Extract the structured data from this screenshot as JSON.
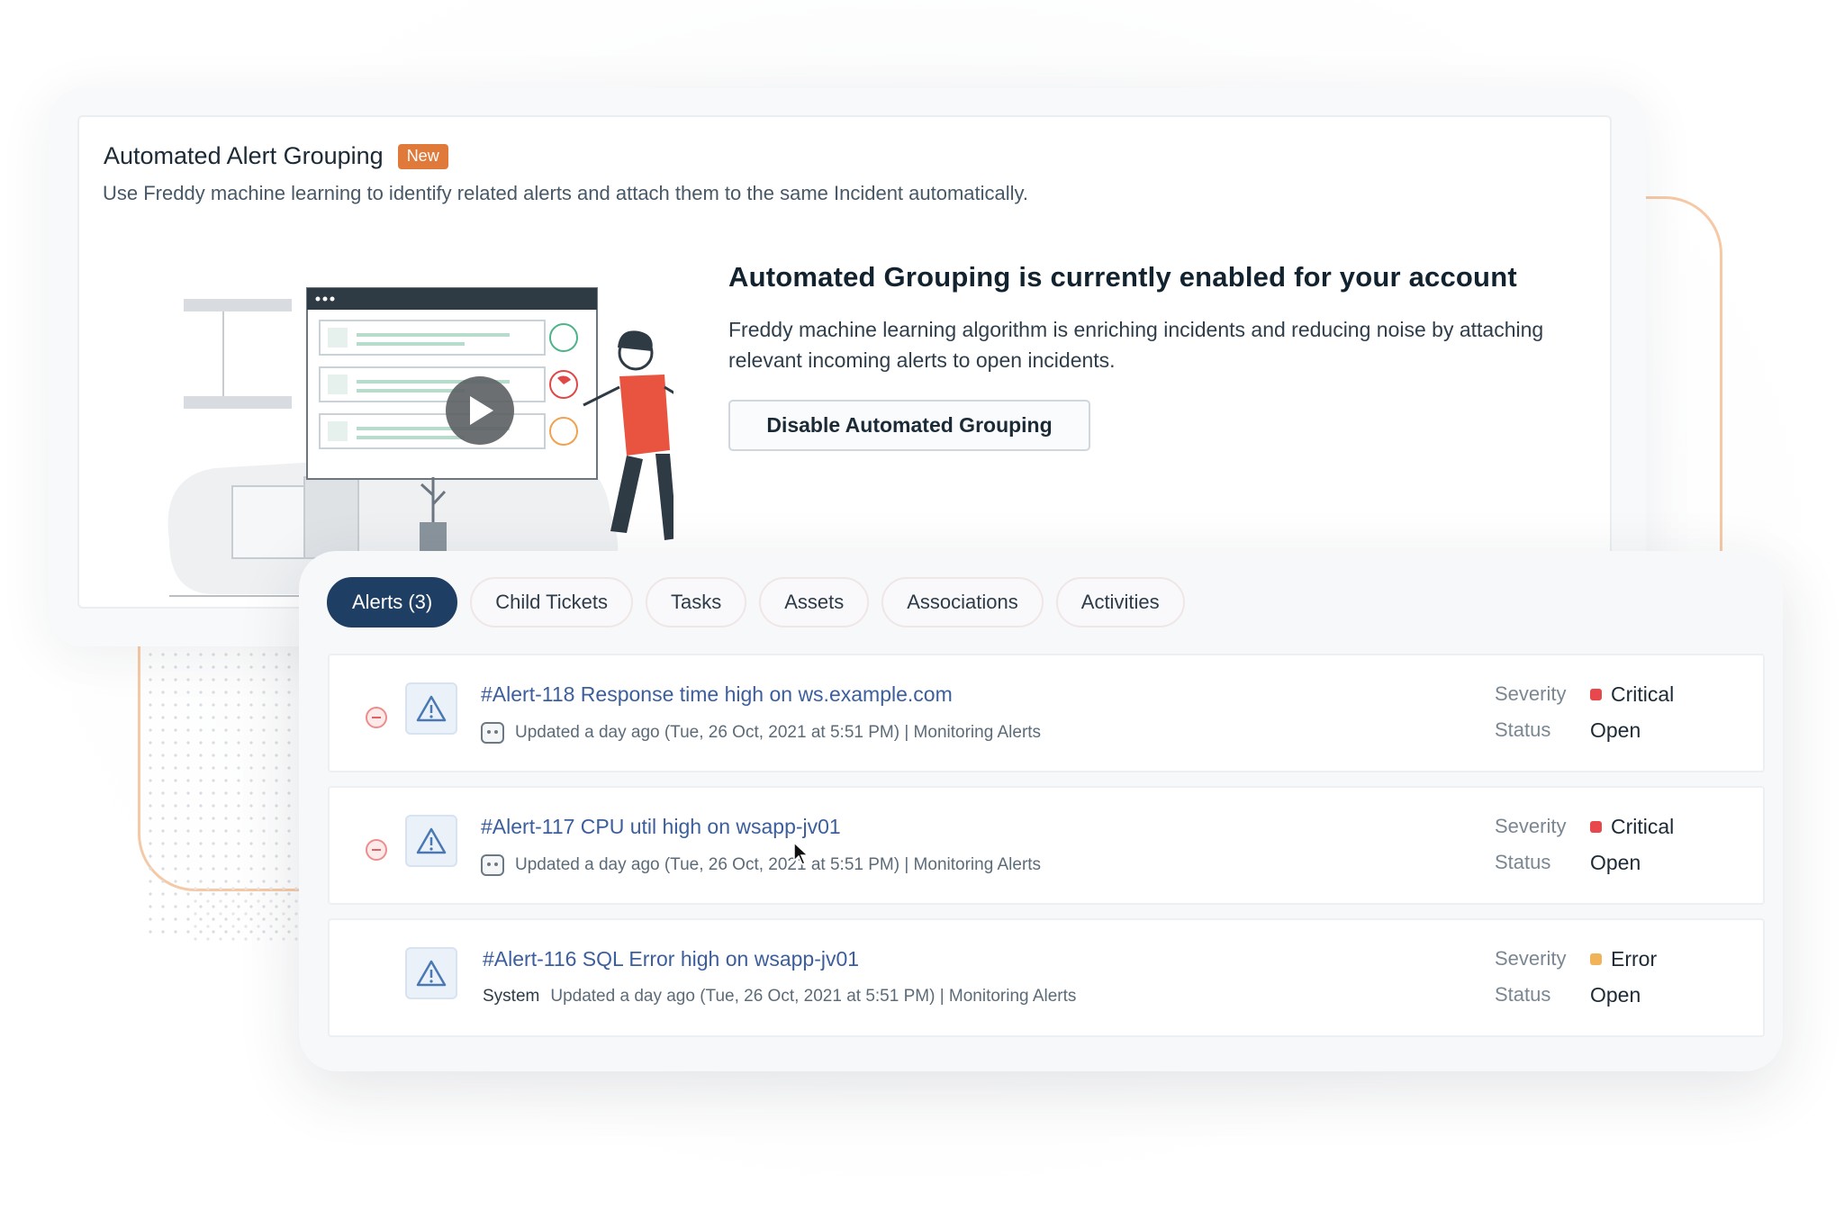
{
  "settings": {
    "title": "Automated Alert Grouping",
    "badge": "New",
    "description": "Use Freddy machine learning to identify related alerts and attach them to the same Incident automatically.",
    "enabled_title": "Automated Grouping is currently enabled for your account",
    "enabled_description": "Freddy machine learning algorithm is enriching incidents and reducing noise by attaching relevant incoming alerts to open incidents.",
    "disable_button": "Disable Automated Grouping"
  },
  "tabs": [
    {
      "label": "Alerts (3)",
      "active": true
    },
    {
      "label": "Child Tickets",
      "active": false
    },
    {
      "label": "Tasks",
      "active": false
    },
    {
      "label": "Assets",
      "active": false
    },
    {
      "label": "Associations",
      "active": false
    },
    {
      "label": "Activities",
      "active": false
    }
  ],
  "alerts": [
    {
      "title": "#Alert-118 Response time high on ws.example.com",
      "source": "",
      "meta": "Updated a day ago (Tue, 26 Oct, 2021 at 5:51 PM) | Monitoring Alerts",
      "severity_label": "Severity",
      "severity": "Critical",
      "severity_color": "#e8474c",
      "status_label": "Status",
      "status": "Open"
    },
    {
      "title": "#Alert-117 CPU util high on wsapp-jv01",
      "source": "",
      "meta": "Updated a day ago (Tue, 26 Oct, 2021 at 5:51 PM) | Monitoring Alerts",
      "severity_label": "Severity",
      "severity": "Critical",
      "severity_color": "#e8474c",
      "status_label": "Status",
      "status": "Open"
    },
    {
      "title": "#Alert-116 SQL Error high on wsapp-jv01",
      "source": "System",
      "meta": "Updated a day ago (Tue, 26 Oct, 2021 at 5:51 PM) | Monitoring Alerts",
      "severity_label": "Severity",
      "severity": "Error",
      "severity_color": "#f0b35a",
      "status_label": "Status",
      "status": "Open"
    }
  ],
  "colors": {
    "accent_navy": "#1f3e63",
    "badge_orange": "#e07a3b",
    "link_blue": "#3c5e9c"
  }
}
